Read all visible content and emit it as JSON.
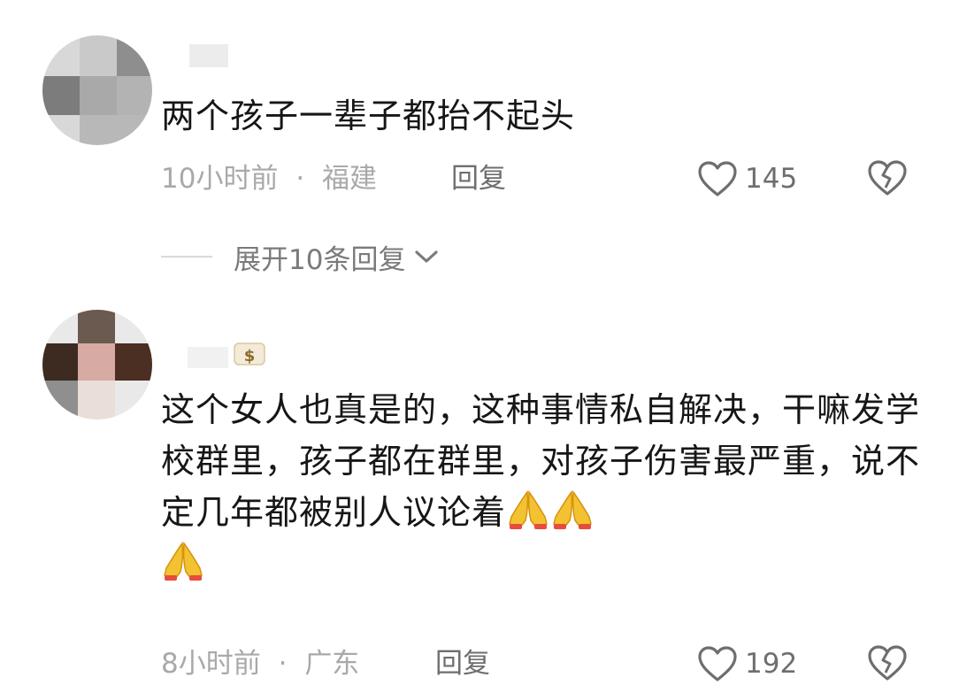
{
  "comments": [
    {
      "username": "",
      "text": "两个孩子一辈子都抬不起头",
      "time": "10小时前",
      "separator": "·",
      "location": "福建",
      "reply_label": "回复",
      "likes": "145",
      "expand_label": "展开10条回复"
    },
    {
      "username": "",
      "username_emoji_icon": "money-bag-icon",
      "text": "这个女人也真是的，这种事情私自解决，干嘛发学校群里，孩子都在群里，对孩子伤害最严重，说不定几年都被别人议论着",
      "trailing_emoji": [
        "folded-hands-icon",
        "folded-hands-icon",
        "folded-hands-icon"
      ],
      "time": "8小时前",
      "separator": "·",
      "location": "广东",
      "reply_label": "回复",
      "likes": "192"
    }
  ],
  "colors": {
    "primary_text": "#161616",
    "meta_text": "#a9a9a9",
    "action_text": "#6e6e6e",
    "divider": "#d9d9d9"
  }
}
